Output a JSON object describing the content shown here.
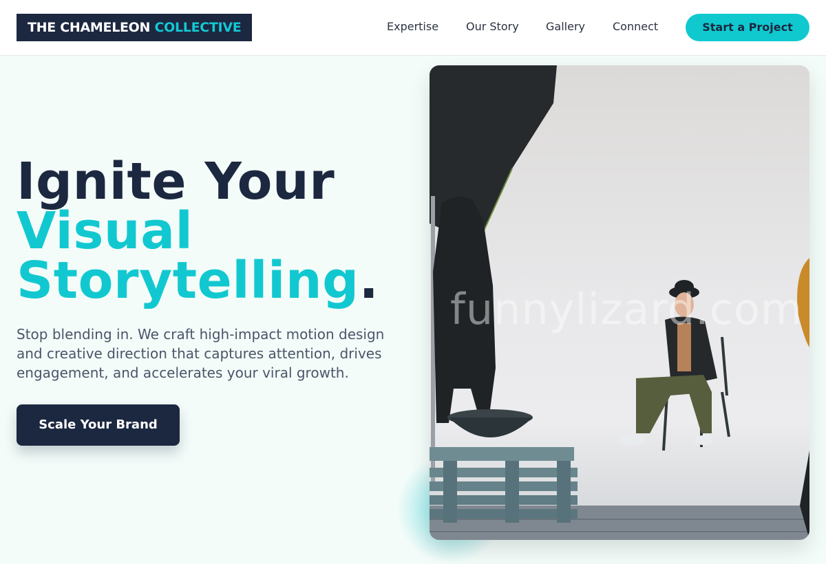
{
  "header": {
    "logo_main": "THE CHAMELEON",
    "logo_accent": "COLLECTIVE",
    "nav": [
      "Expertise",
      "Our Story",
      "Gallery",
      "Connect"
    ],
    "cta_label": "Start a Project"
  },
  "hero": {
    "title_line1": "Ignite Your",
    "title_accent_line2": "Visual",
    "title_accent_line3": "Storytelling",
    "title_period": ".",
    "subtitle": "Stop blending in. We craft high-impact motion design and creative direction that captures attention, drives engagement, and accelerates your viral growth.",
    "button_label": "Scale Your Brand"
  },
  "photo": {
    "watermark": "funnylizard.com"
  },
  "colors": {
    "navy": "#1c2740",
    "accent": "#12c8d0",
    "background": "#f3fcf9"
  }
}
